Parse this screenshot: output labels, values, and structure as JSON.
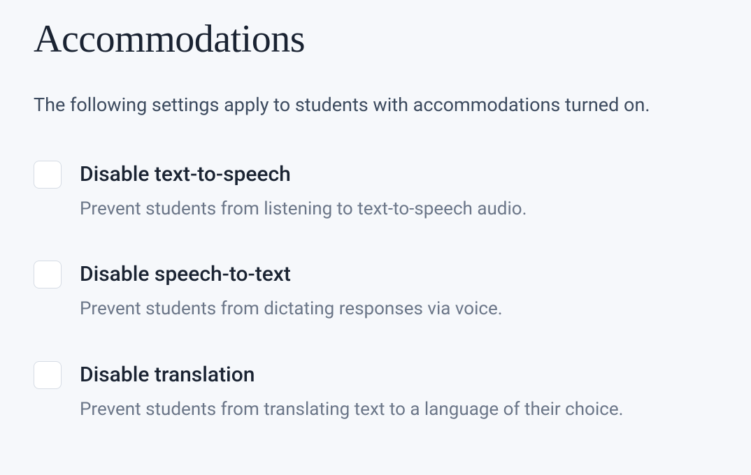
{
  "title": "Accommodations",
  "description": "The following settings apply to students with accommodations turned on.",
  "options": [
    {
      "label": "Disable text-to-speech",
      "description": "Prevent students from listening to text-to-speech audio."
    },
    {
      "label": "Disable speech-to-text",
      "description": "Prevent students from dictating responses via voice."
    },
    {
      "label": "Disable translation",
      "description": "Prevent students from translating text to a language of their choice."
    }
  ]
}
